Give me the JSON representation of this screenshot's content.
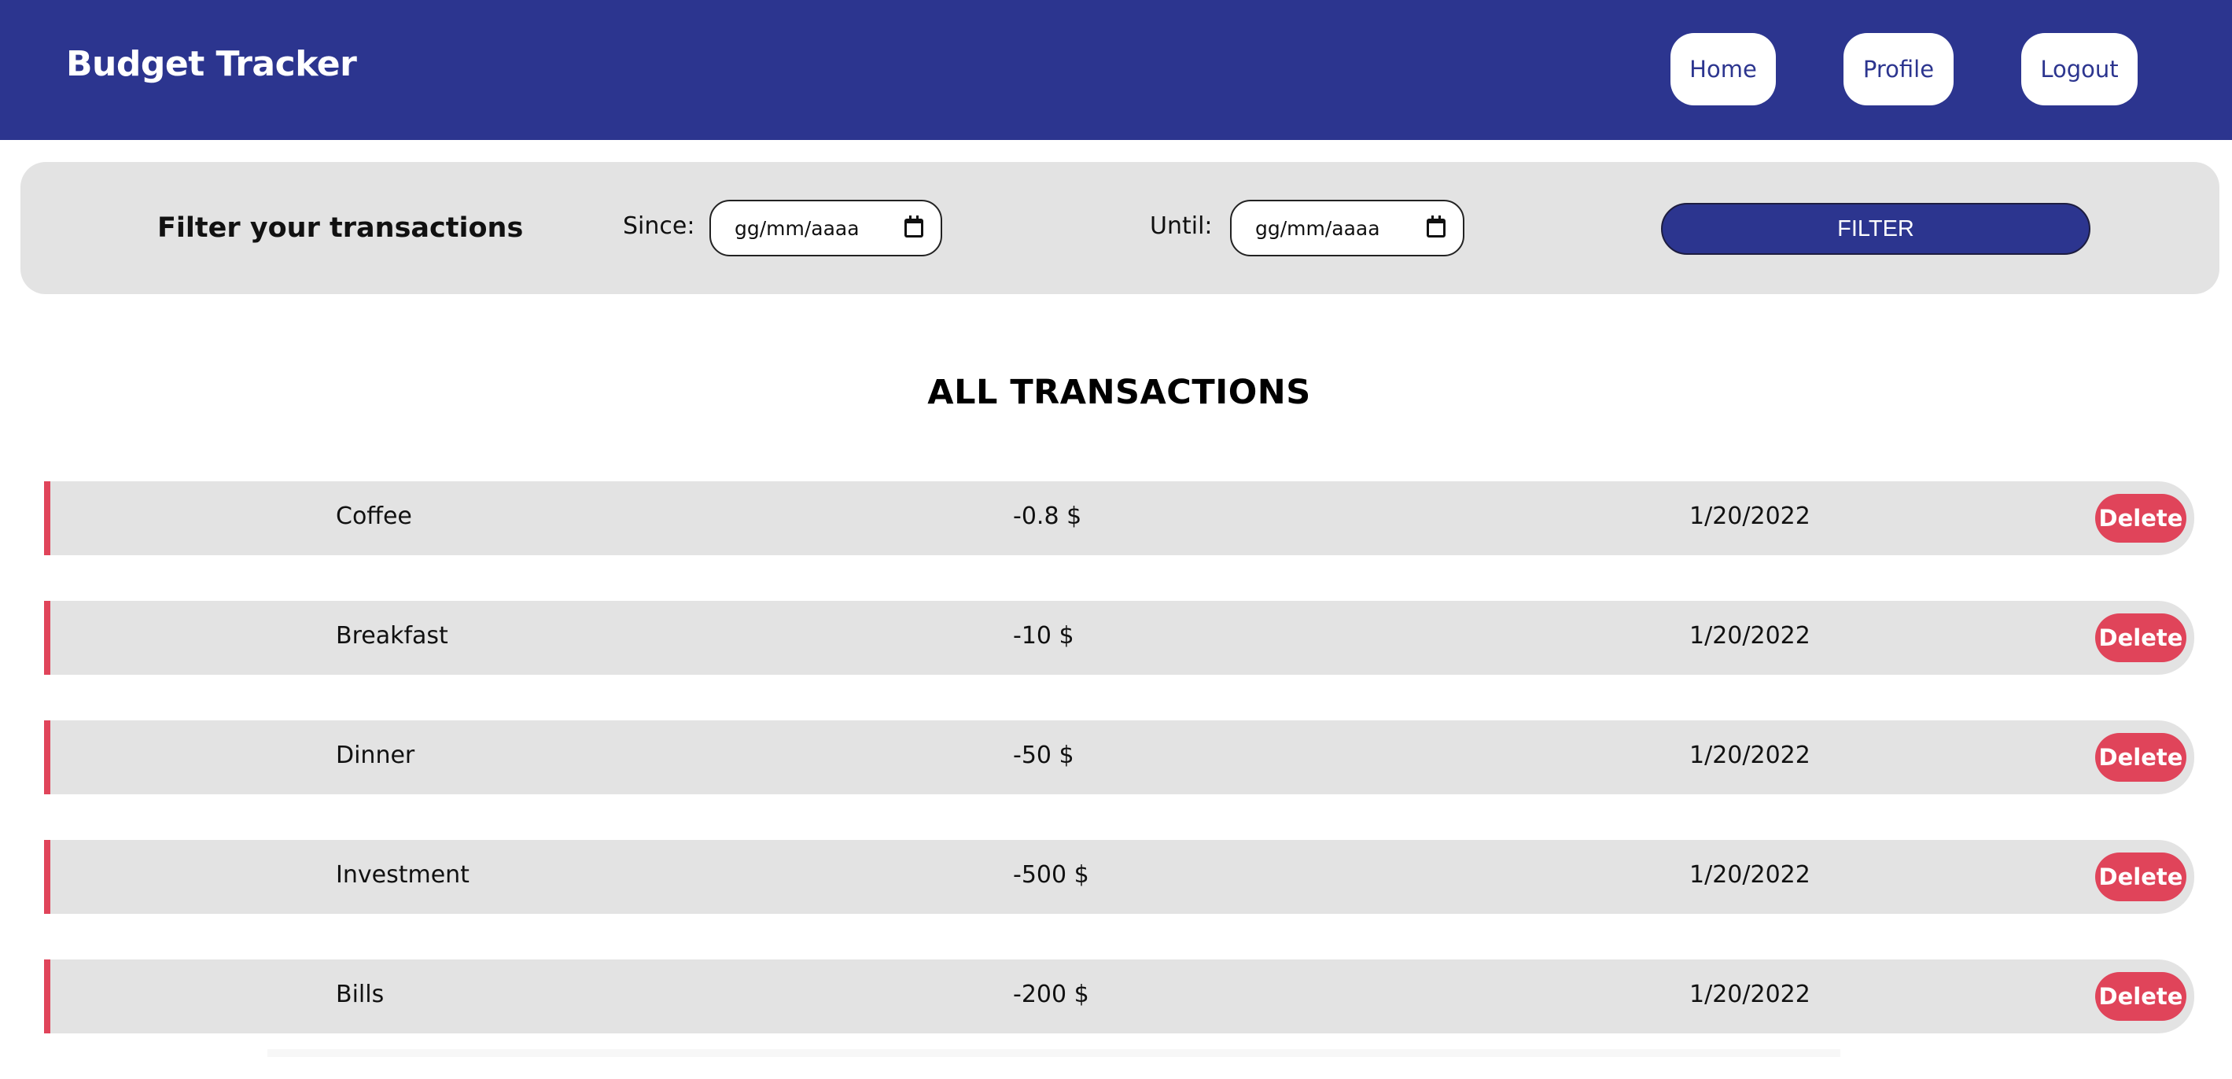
{
  "header": {
    "brand": "Budget Tracker",
    "nav": [
      {
        "label": "Home"
      },
      {
        "label": "Profile"
      },
      {
        "label": "Logout"
      }
    ]
  },
  "filter": {
    "title": "Filter your transactions",
    "since_label": "Since:",
    "until_label": "Until:",
    "since_value": "gg/mm/aaaa",
    "until_value": "gg/mm/aaaa",
    "button_label": "FILTER"
  },
  "transactions_title": "ALL TRANSACTIONS",
  "transactions": [
    {
      "name": "Coffee",
      "amount": "-0.8 $",
      "date": "1/20/2022",
      "action": "Delete"
    },
    {
      "name": "Breakfast",
      "amount": "-10 $",
      "date": "1/20/2022",
      "action": "Delete"
    },
    {
      "name": "Dinner",
      "amount": "-50 $",
      "date": "1/20/2022",
      "action": "Delete"
    },
    {
      "name": "Investment",
      "amount": "-500 $",
      "date": "1/20/2022",
      "action": "Delete"
    },
    {
      "name": "Bills",
      "amount": "-200 $",
      "date": "1/20/2022",
      "action": "Delete"
    }
  ],
  "colors": {
    "primary": "#2c358f",
    "accent_red": "#e0445a",
    "panel_gray": "#e3e3e3"
  }
}
